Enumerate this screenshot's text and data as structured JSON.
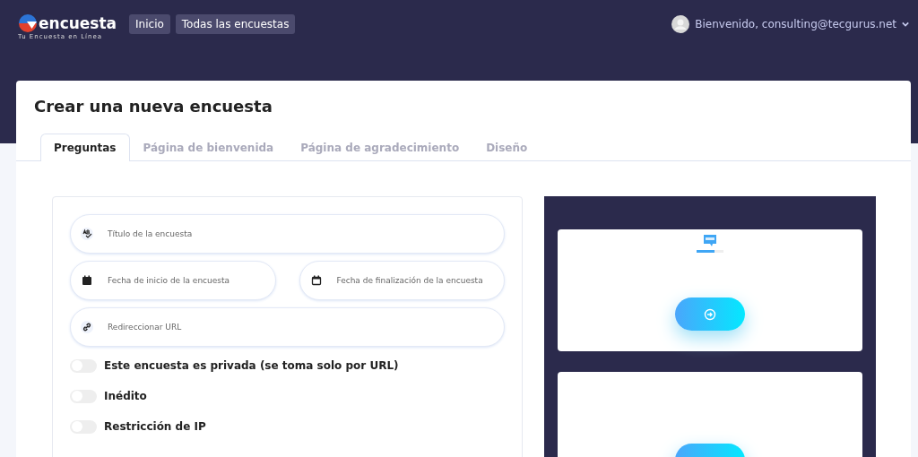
{
  "brand": {
    "name": "encuesta",
    "tagline": "Tu Encuesta en Línea"
  },
  "nav": [
    {
      "label": "Inicio"
    },
    {
      "label": "Todas las encuestas"
    }
  ],
  "user": {
    "greeting": "Bienvenido, consulting@tecgurus.net"
  },
  "page_title": "Crear una nueva encuesta",
  "tabs": [
    {
      "label": "Preguntas",
      "selected": true
    },
    {
      "label": "Página de bienvenida",
      "selected": false
    },
    {
      "label": "Página de agradecimiento",
      "selected": false
    },
    {
      "label": "Diseño",
      "selected": false
    }
  ],
  "fields": [
    {
      "placeholder": "Título de la encuesta"
    },
    {
      "placeholder": "Fecha de inicio de la encuesta"
    },
    {
      "placeholder": "Fecha de finalización de la encuesta"
    },
    {
      "placeholder": "Redireccionar URL"
    }
  ],
  "toggles": [
    {
      "label": "Este encuesta es privada (se toma solo por URL)",
      "on": false
    },
    {
      "label": "Inédito",
      "on": false
    },
    {
      "label": "Restricción de IP",
      "on": false
    }
  ],
  "preview": {
    "progress": {
      "level": 0.67
    }
  }
}
